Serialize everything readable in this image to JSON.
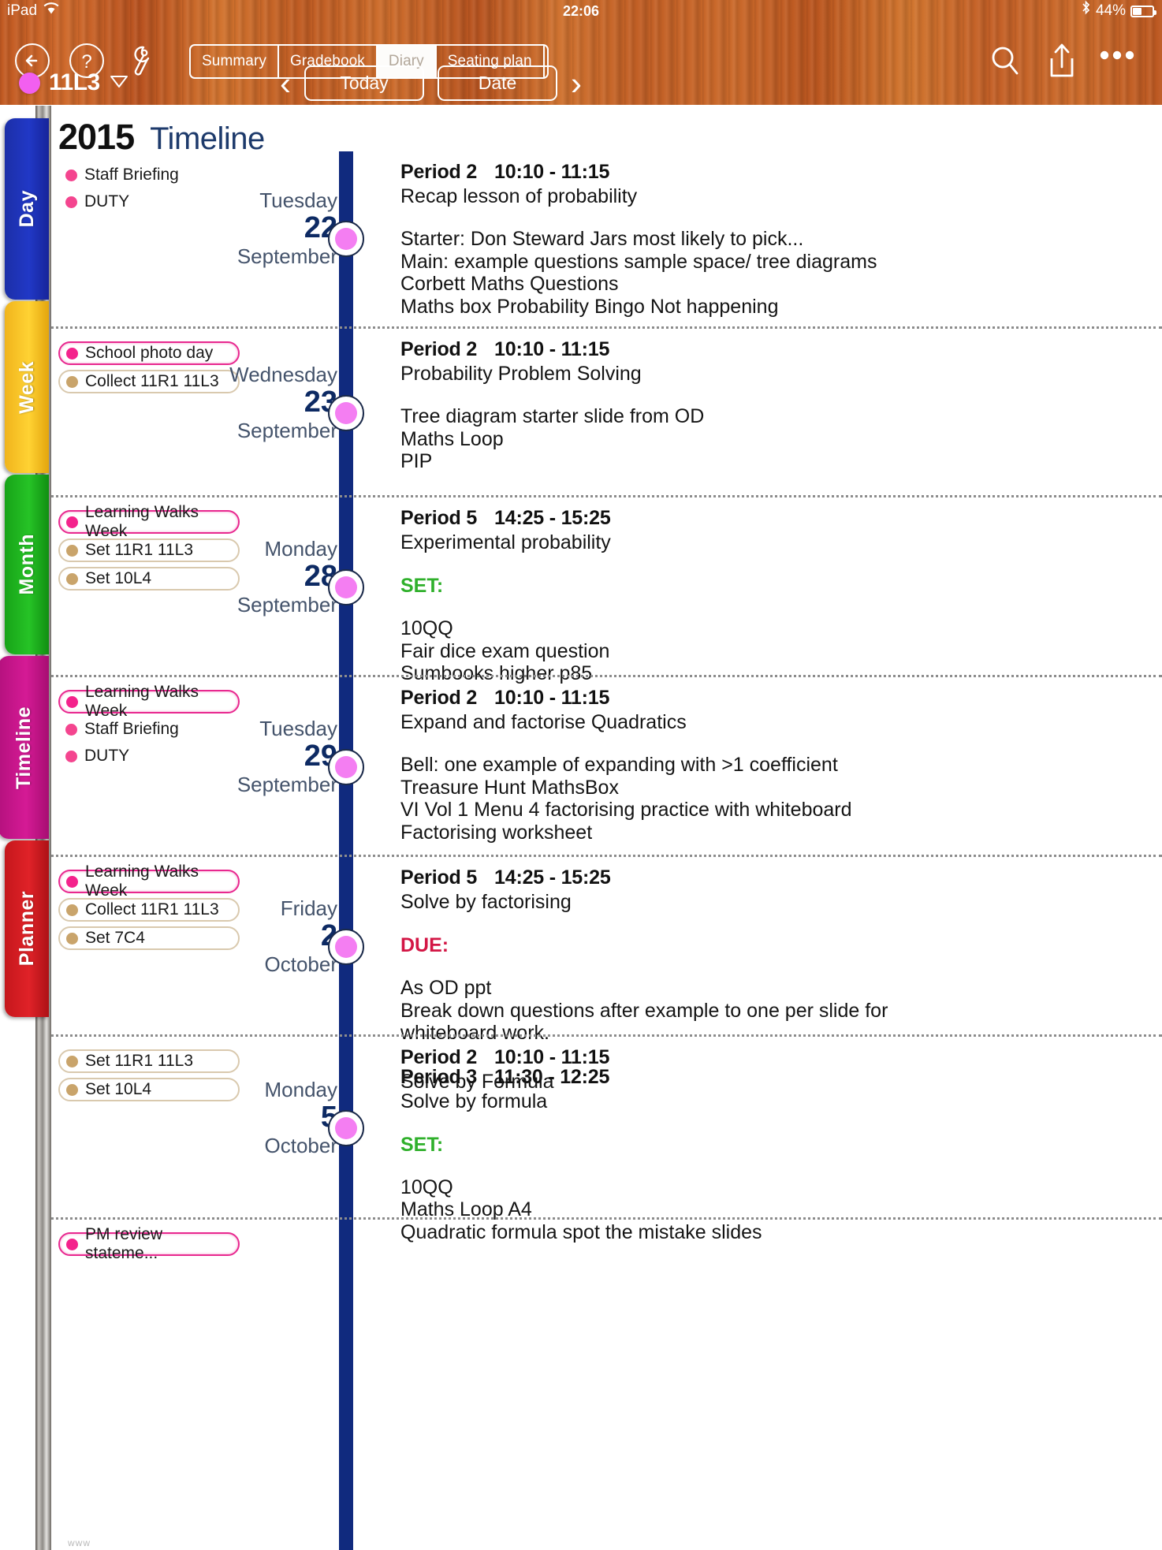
{
  "status_bar": {
    "device": "iPad",
    "wifi_icon": "wifi-icon",
    "time": "22:06",
    "bluetooth_icon": "bluetooth-icon",
    "battery_percent": "44%",
    "battery_icon": "battery-icon"
  },
  "toolbar": {
    "back_icon": "back-arrow-icon",
    "help_icon": "question-mark-icon",
    "tools_icon": "wrench-icon",
    "search_icon": "search-icon",
    "share_icon": "share-upload-icon",
    "more_icon": "more-dots-icon",
    "tabs": [
      {
        "label": "Summary",
        "active": false
      },
      {
        "label": "Gradebook",
        "active": false
      },
      {
        "label": "Diary",
        "active": true
      },
      {
        "label": "Seating plan",
        "active": false
      },
      {
        "label": "○○○",
        "active": false
      }
    ]
  },
  "subtoolbar": {
    "class_name": "11L3",
    "class_dot_color": "#f25ff0",
    "caret_icon": "chevron-down-icon",
    "prev_icon": "chevron-left-icon",
    "next_icon": "chevron-right-icon",
    "today_label": "Today",
    "date_label": "Date"
  },
  "side_tabs": [
    {
      "label": "Day",
      "color": "#2138c6",
      "active": false
    },
    {
      "label": "Week",
      "color": "#ffd233",
      "active": false
    },
    {
      "label": "Month",
      "color": "#26c326",
      "active": false
    },
    {
      "label": "Timeline",
      "color": "#d51a95",
      "active": true
    },
    {
      "label": "Planner",
      "color": "#e02228",
      "active": false
    }
  ],
  "page": {
    "year": "2015",
    "view": "Timeline",
    "watermark": "www"
  },
  "timeline_rows": [
    {
      "chips": [
        {
          "text": "Staff Briefing",
          "style": "bare",
          "dot": "#f4458f"
        },
        {
          "text": "DUTY",
          "style": "bare",
          "dot": "#f4458f"
        }
      ],
      "date": {
        "dow": "Tuesday",
        "day": "22",
        "month": "September"
      },
      "lessons": [
        {
          "period": "Period 2",
          "time": "10:10 - 11:15",
          "subtitle": "Recap lesson of probability",
          "body": [
            "Starter: Don Steward Jars most likely to pick...",
            "Main: example questions sample space/ tree diagrams",
            "Corbett Maths Questions",
            "Maths box Probability Bingo Not happening"
          ]
        }
      ]
    },
    {
      "chips": [
        {
          "text": "School photo day",
          "style": "pinkish",
          "dot": "#f4228c"
        },
        {
          "text": "Collect 11R1 11L3",
          "style": "tan",
          "dot": "#c9a46b"
        }
      ],
      "date": {
        "dow": "Wednesday",
        "day": "23",
        "month": "September"
      },
      "lessons": [
        {
          "period": "Period 2",
          "time": "10:10 - 11:15",
          "subtitle": "Probability Problem Solving",
          "body": [
            "Tree diagram starter slide from OD",
            "Maths Loop",
            "PIP"
          ]
        }
      ]
    },
    {
      "chips": [
        {
          "text": "Learning Walks Week",
          "style": "pinkish",
          "dot": "#f4228c"
        },
        {
          "text": "Set 11R1 11L3",
          "style": "tan",
          "dot": "#c9a46b"
        },
        {
          "text": "Set 10L4",
          "style": "tan",
          "dot": "#c9a46b"
        }
      ],
      "date": {
        "dow": "Monday",
        "day": "28",
        "month": "September"
      },
      "lessons": [
        {
          "period": "Period 5",
          "time": "14:25 - 15:25",
          "subtitle": "Experimental probability",
          "tag": "SET:",
          "tag_type": "set",
          "body": [
            "10QQ",
            "Fair dice exam question",
            "Sumbooks higher p85"
          ]
        }
      ]
    },
    {
      "chips": [
        {
          "text": "Learning Walks Week",
          "style": "pinkish",
          "dot": "#f4228c"
        },
        {
          "text": "Staff Briefing",
          "style": "bare",
          "dot": "#f4458f"
        },
        {
          "text": "DUTY",
          "style": "bare",
          "dot": "#f4458f"
        }
      ],
      "date": {
        "dow": "Tuesday",
        "day": "29",
        "month": "September"
      },
      "lessons": [
        {
          "period": "Period 2",
          "time": "10:10 - 11:15",
          "subtitle": "Expand and factorise Quadratics",
          "body": [
            "Bell: one example of expanding with >1 coefficient",
            "Treasure Hunt MathsBox",
            "VI Vol 1 Menu 4 factorising practice with whiteboard",
            "Factorising worksheet"
          ]
        }
      ]
    },
    {
      "chips": [
        {
          "text": "Learning Walks Week",
          "style": "pinkish",
          "dot": "#f4228c"
        },
        {
          "text": "Collect 11R1 11L3",
          "style": "tan",
          "dot": "#c9a46b"
        },
        {
          "text": "Set 7C4",
          "style": "tan",
          "dot": "#c9a46b"
        }
      ],
      "date": {
        "dow": "Friday",
        "day": "2",
        "month": "October"
      },
      "lessons": [
        {
          "period": "Period 5",
          "time": "14:25 - 15:25",
          "subtitle": "Solve by factorising",
          "tag": "DUE:",
          "tag_type": "due",
          "body": [
            "As OD ppt",
            "Break down questions after example to one per slide for",
            "whiteboard work."
          ]
        },
        {
          "period": "Period 3",
          "time": "11:30 - 12:25",
          "subtitle": "Solve by formula",
          "tag": "SET:",
          "tag_type": "set",
          "body": [
            "10QQ",
            "Maths Loop A4",
            "Quadratic formula spot the mistake slides"
          ]
        }
      ]
    },
    {
      "chips": [
        {
          "text": "Set 11R1 11L3",
          "style": "tan",
          "dot": "#c9a46b"
        },
        {
          "text": "Set 10L4",
          "style": "tan",
          "dot": "#c9a46b"
        }
      ],
      "date": {
        "dow": "Monday",
        "day": "5",
        "month": "October"
      },
      "lessons": [
        {
          "period": "Period 2",
          "time": "10:10 - 11:15",
          "subtitle": "Solve by Formula",
          "body": []
        }
      ]
    },
    {
      "chips": [
        {
          "text": "PM review stateme...",
          "style": "pinkish",
          "dot": "#f4228c"
        }
      ],
      "date": null,
      "lessons": []
    }
  ]
}
